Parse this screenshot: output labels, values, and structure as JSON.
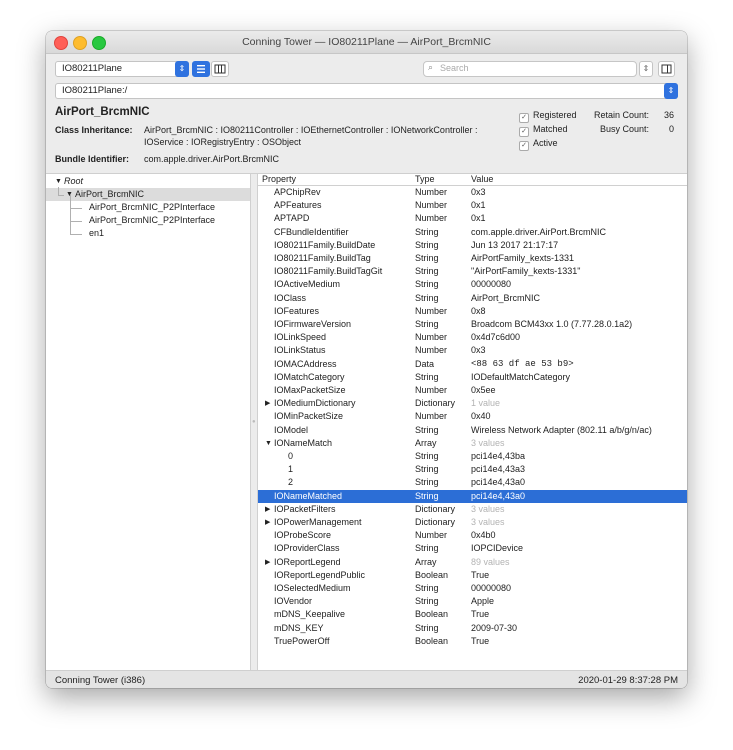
{
  "window": {
    "title": "Conning Tower — IO80211Plane — AirPort_BrcmNIC",
    "colors": {
      "close": "#ff5f57",
      "minimize": "#febc2e",
      "zoom": "#28c840",
      "accent": "#2c6ed6"
    }
  },
  "toolbar": {
    "plane_select": "IO80211Plane",
    "search_placeholder": "Search",
    "path_value": "IO80211Plane:/"
  },
  "info": {
    "name": "AirPort_BrcmNIC",
    "class_label": "Class Inheritance:",
    "class_value": "AirPort_BrcmNIC : IO80211Controller : IOEthernetController : IONetworkController : IOService : IORegistryEntry : OSObject",
    "bundle_label": "Bundle Identifier:",
    "bundle_value": "com.apple.driver.AirPort.BrcmNIC",
    "registered_label": "Registered",
    "matched_label": "Matched",
    "active_label": "Active",
    "retain_label": "Retain Count:",
    "retain_value": "36",
    "busy_label": "Busy Count:",
    "busy_value": "0"
  },
  "tree": {
    "root": "Root",
    "node": "AirPort_BrcmNIC",
    "children": [
      "AirPort_BrcmNIC_P2PInterface",
      "AirPort_BrcmNIC_P2PInterface",
      "en1"
    ]
  },
  "table": {
    "headers": {
      "property": "Property",
      "type": "Type",
      "value": "Value"
    },
    "rows": [
      {
        "property": "APChipRev",
        "type": "Number",
        "value": "0x3"
      },
      {
        "property": "APFeatures",
        "type": "Number",
        "value": "0x1"
      },
      {
        "property": "APTAPD",
        "type": "Number",
        "value": "0x1"
      },
      {
        "property": "CFBundleIdentifier",
        "type": "String",
        "value": "com.apple.driver.AirPort.BrcmNIC"
      },
      {
        "property": "IO80211Family.BuildDate",
        "type": "String",
        "value": "Jun 13 2017 21:17:17"
      },
      {
        "property": "IO80211Family.BuildTag",
        "type": "String",
        "value": "AirPortFamily_kexts-1331"
      },
      {
        "property": "IO80211Family.BuildTagGit",
        "type": "String",
        "value": "\"AirPortFamily_kexts-1331\""
      },
      {
        "property": "IOActiveMedium",
        "type": "String",
        "value": "00000080"
      },
      {
        "property": "IOClass",
        "type": "String",
        "value": "AirPort_BrcmNIC"
      },
      {
        "property": "IOFeatures",
        "type": "Number",
        "value": "0x8"
      },
      {
        "property": "IOFirmwareVersion",
        "type": "String",
        "value": "Broadcom BCM43xx 1.0 (7.77.28.0.1a2)"
      },
      {
        "property": "IOLinkSpeed",
        "type": "Number",
        "value": "0x4d7c6d00"
      },
      {
        "property": "IOLinkStatus",
        "type": "Number",
        "value": "0x3"
      },
      {
        "property": "IOMACAddress",
        "type": "Data",
        "value": "<88 63 df ae 53 b9>"
      },
      {
        "property": "IOMatchCategory",
        "type": "String",
        "value": "IODefaultMatchCategory"
      },
      {
        "property": "IOMaxPacketSize",
        "type": "Number",
        "value": "0x5ee"
      },
      {
        "property": "IOMediumDictionary",
        "type": "Dictionary",
        "value": "1 value"
      },
      {
        "property": "IOMinPacketSize",
        "type": "Number",
        "value": "0x40"
      },
      {
        "property": "IOModel",
        "type": "String",
        "value": "Wireless Network Adapter (802.11 a/b/g/n/ac)"
      },
      {
        "property": "IONameMatch",
        "type": "Array",
        "value": "3 values"
      },
      {
        "property": "0",
        "type": "String",
        "value": "pci14e4,43ba"
      },
      {
        "property": "1",
        "type": "String",
        "value": "pci14e4,43a3"
      },
      {
        "property": "2",
        "type": "String",
        "value": "pci14e4,43a0"
      },
      {
        "property": "IONameMatched",
        "type": "String",
        "value": "pci14e4,43a0"
      },
      {
        "property": "IOPacketFilters",
        "type": "Dictionary",
        "value": "3 values"
      },
      {
        "property": "IOPowerManagement",
        "type": "Dictionary",
        "value": "3 values"
      },
      {
        "property": "IOProbeScore",
        "type": "Number",
        "value": "0x4b0"
      },
      {
        "property": "IOProviderClass",
        "type": "String",
        "value": "IOPCIDevice"
      },
      {
        "property": "IOReportLegend",
        "type": "Array",
        "value": "89 values"
      },
      {
        "property": "IOReportLegendPublic",
        "type": "Boolean",
        "value": "True"
      },
      {
        "property": "IOSelectedMedium",
        "type": "String",
        "value": "00000080"
      },
      {
        "property": "IOVendor",
        "type": "String",
        "value": "Apple"
      },
      {
        "property": "mDNS_Keepalive",
        "type": "Boolean",
        "value": "True"
      },
      {
        "property": "mDNS_KEY",
        "type": "String",
        "value": "2009-07-30"
      },
      {
        "property": "TruePowerOff",
        "type": "Boolean",
        "value": "True"
      }
    ]
  },
  "status": {
    "left": "Conning Tower (i386)",
    "right": "2020-01-29 8:37:28 PM"
  }
}
